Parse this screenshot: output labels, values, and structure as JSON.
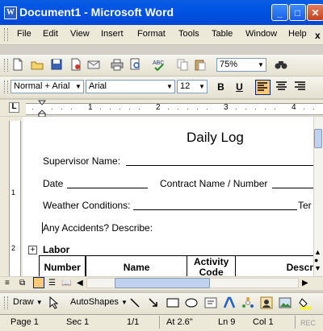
{
  "window": {
    "title": "Document1 - Microsoft Word",
    "minimize": "_",
    "maximize": "□",
    "close": "✕"
  },
  "menu": [
    "File",
    "Edit",
    "View",
    "Insert",
    "Format",
    "Tools",
    "Table",
    "Window",
    "Help"
  ],
  "menu_close": "x",
  "standard_toolbar": {
    "zoom": "75%"
  },
  "formatting_toolbar": {
    "style": "Normal + Arial",
    "font": "Arial",
    "size": "12",
    "bold": "B",
    "underline": "U"
  },
  "ruler": {
    "numbers": [
      "1",
      "2",
      "3",
      "4"
    ],
    "tab_selector": "L"
  },
  "vertical_ruler": {
    "numbers": [
      "1",
      "2"
    ]
  },
  "document": {
    "heading": "Daily Log",
    "supervisor_label": "Supervisor Name:",
    "date_label": "Date",
    "contract_label": "Contract Name / Number",
    "weather_label": "Weather Conditions:",
    "weather_suffix": "Ter",
    "accidents_label": "Any Accidents? Describe:",
    "section_title": "Labor",
    "table_headers": [
      "Number",
      "Name",
      "Activity Code",
      "Descr"
    ]
  },
  "draw_toolbar": {
    "draw": "Draw",
    "autoshapes": "AutoShapes"
  },
  "status": {
    "page": "Page  1",
    "sec": "Sec  1",
    "pages": "1/1",
    "at": "At  2.6\"",
    "ln": "Ln  9",
    "col": "Col  1",
    "rec": "REC"
  },
  "colors": {
    "title_bar": "#0054e3",
    "active_button": "#ffc877"
  }
}
